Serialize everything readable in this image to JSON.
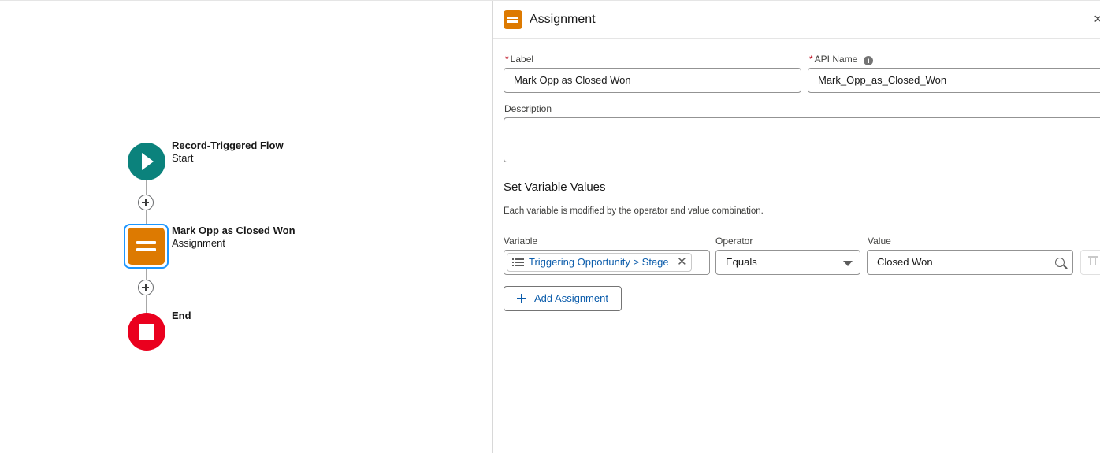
{
  "canvas": {
    "start_node": {
      "title": "Record-Triggered Flow",
      "subtitle": "Start",
      "color": "#0b827c"
    },
    "assignment_node": {
      "title": "Mark Opp as Closed Won",
      "subtitle": "Assignment",
      "color": "#dd7a01"
    },
    "end_node": {
      "title": "End",
      "color": "#ea001e"
    },
    "add_element_icon": "plus-circle-icon"
  },
  "panel": {
    "header": {
      "title": "Assignment",
      "icon": "assignment-icon",
      "close_icon": "close-icon",
      "close_glyph": "×"
    },
    "label_field": {
      "required_marker": "*",
      "label": "Label",
      "value": "Mark Opp as Closed Won"
    },
    "api_name_field": {
      "required_marker": "*",
      "label": "API Name",
      "value": "Mark_Opp_as_Closed_Won",
      "info_icon": "info-icon"
    },
    "description_field": {
      "label": "Description",
      "value": ""
    },
    "section": {
      "title": "Set Variable Values",
      "help_text": "Each variable is modified by the operator and value combination."
    },
    "columns": {
      "variable": "Variable",
      "operator": "Operator",
      "value": "Value"
    },
    "row": {
      "variable": "Triggering Opportunity > Stage",
      "operator": "Equals",
      "value": "Closed Won"
    },
    "add_button": "Add Assignment"
  }
}
